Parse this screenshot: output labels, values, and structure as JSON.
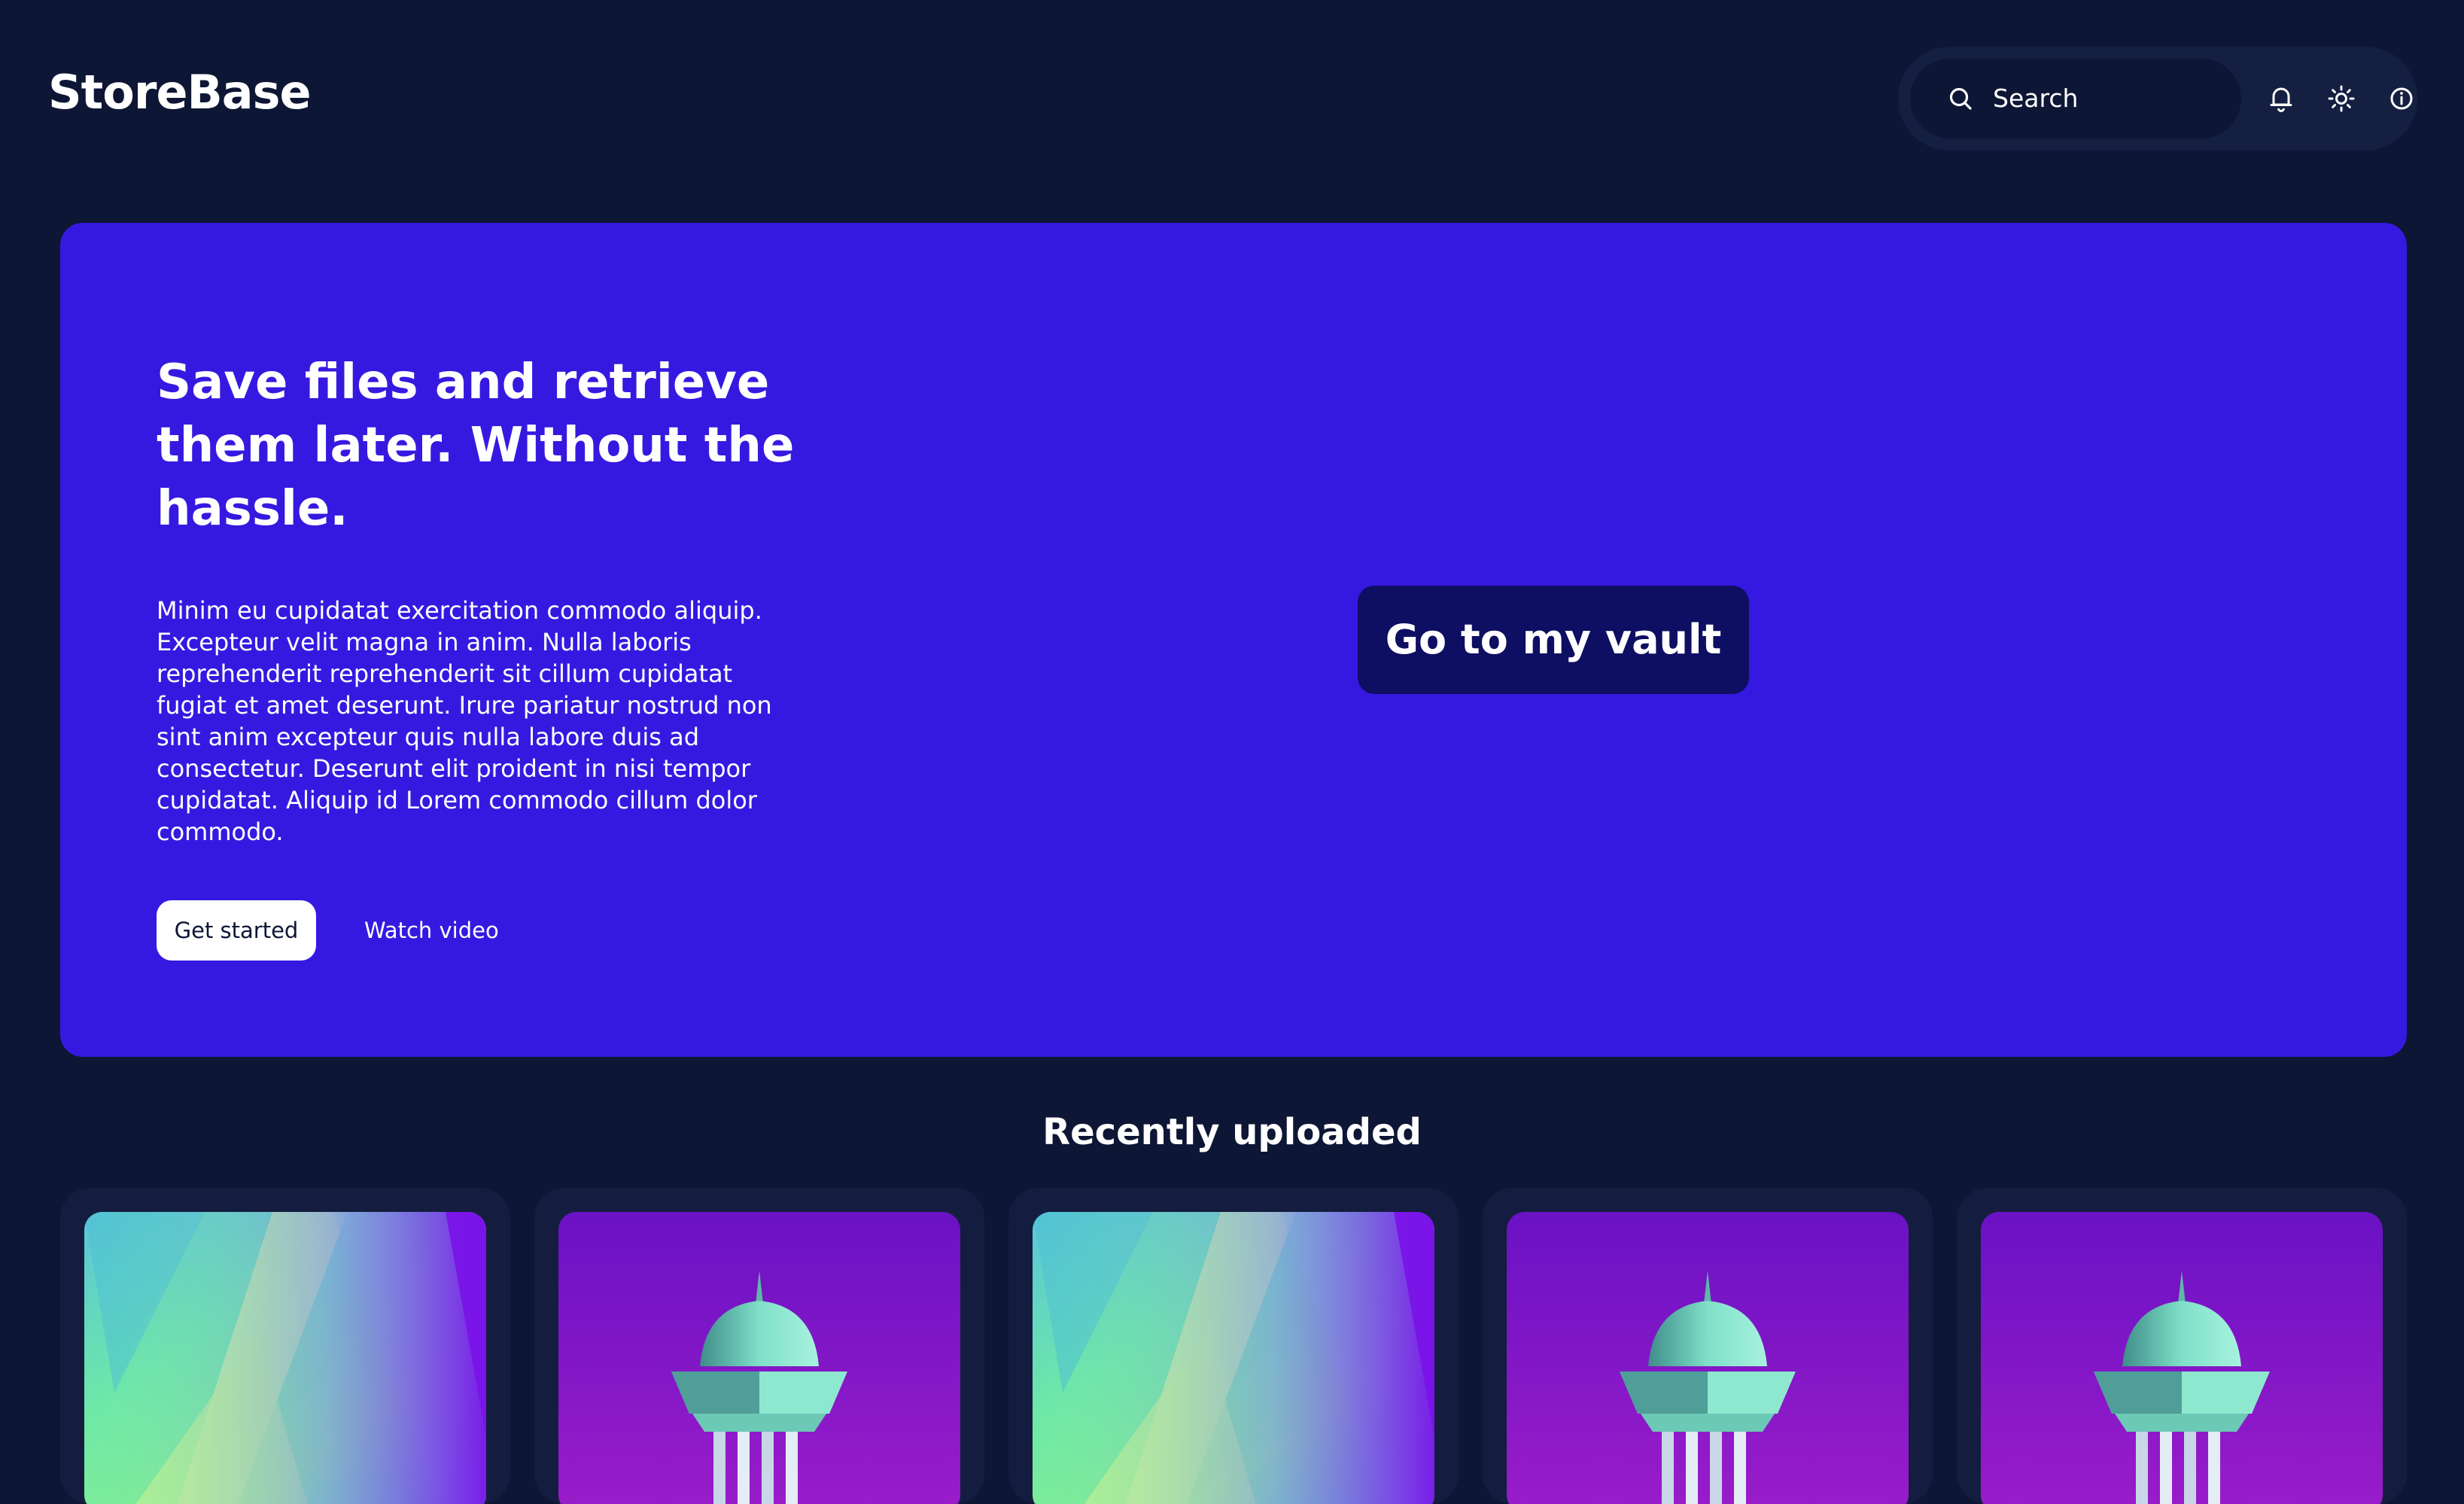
{
  "header": {
    "brand": "StoreBase",
    "search": {
      "label": "Search"
    },
    "icons": [
      "bell-icon",
      "sun-icon",
      "info-icon"
    ]
  },
  "hero": {
    "title": "Save files and retrieve them later. Without the hassle.",
    "body": "Minim eu cupidatat exercitation commodo aliquip. Excepteur velit magna in anim. Nulla laboris reprehenderit reprehenderit sit cillum cupidatat fugiat et amet deserunt. Irure pariatur nostrud non sint anim excepteur quis nulla labore duis ad consectetur. Deserunt elit proident in nisi tempor cupidatat. Aliquip id Lorem commodo cillum dolor commodo.",
    "primary_cta": "Get started",
    "secondary_cta": "Watch video",
    "vault_button": "Go to my vault"
  },
  "recent": {
    "title": "Recently uploaded",
    "items": [
      {
        "thumbnail": "abstract-gradient-image"
      },
      {
        "thumbnail": "tower-image"
      },
      {
        "thumbnail": "abstract-gradient-image"
      },
      {
        "thumbnail": "tower-image"
      },
      {
        "thumbnail": "tower-image"
      }
    ]
  },
  "colors": {
    "background": "#0e1635",
    "hero": "#3619e0",
    "vault_button": "#0e0e62",
    "card": "#141d3f",
    "toolbar": "#151f41"
  }
}
